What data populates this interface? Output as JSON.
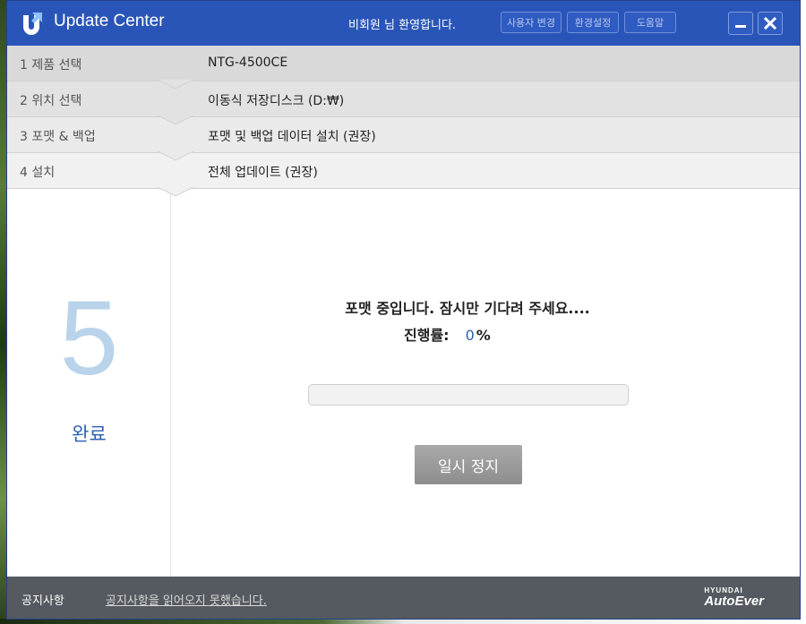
{
  "window": {
    "app_title": "Update Center",
    "welcome": "비회원 님 환영합니다.",
    "buttons": {
      "user_change": "사용자 변경",
      "settings": "환경설정",
      "help": "도움말"
    }
  },
  "steps": [
    {
      "label": "1  제품 선택",
      "value": "NTG-4500CE"
    },
    {
      "label": "2  위치 선택",
      "value": "이동식 저장디스크 (D:₩)"
    },
    {
      "label": "3  포맷 & 백업",
      "value": "포맷 및 백업 데이터 설치 (권장)"
    },
    {
      "label": "4  설치",
      "value": "전체 업데이트 (권장)"
    }
  ],
  "current_step": {
    "number": "5",
    "label": "완료"
  },
  "main": {
    "status_message": "포맷 중입니다. 잠시만 기다려 주세요....",
    "progress_label": "진행률:",
    "progress_value": "0",
    "progress_unit": "%",
    "progress_percent": 0,
    "pause_button": "일시 정지"
  },
  "footer": {
    "notice_title": "공지사항",
    "notice_text": "공지사항을 읽어오지 못했습니다.",
    "brand_top": "HYUNDAI",
    "brand_main": "AutoEver"
  },
  "colors": {
    "titlebar": "#2a55b8",
    "accent": "#2a62b2",
    "big_number": "#b9d3ea",
    "footer": "#555a60"
  }
}
